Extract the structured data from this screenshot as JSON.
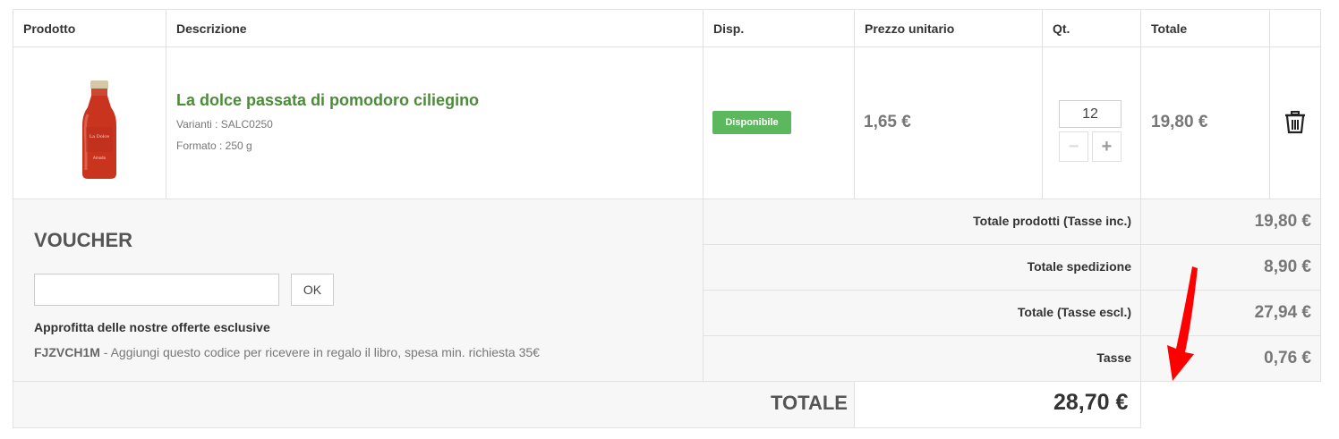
{
  "headers": {
    "product": "Prodotto",
    "description": "Descrizione",
    "availability": "Disp.",
    "unit_price": "Prezzo unitario",
    "qty": "Qt.",
    "total": "Totale"
  },
  "item": {
    "name": "La dolce passata di pomodoro ciliegino",
    "variant": "Varianti : SALC0250",
    "format": "Formato : 250 g",
    "availability": "Disponibile",
    "unit_price": "1,65 €",
    "quantity": "12",
    "total": "19,80 €",
    "image_icon": "tomato-sauce-bottle"
  },
  "voucher": {
    "title": "VOUCHER",
    "input_value": "",
    "ok_label": "OK",
    "offer_title": "Approfitta delle nostre offerte esclusive",
    "offer_code": "FJZVCH1M",
    "offer_text": " - Aggiungi questo codice per ricevere in regalo il libro, spesa min. richiesta 35€"
  },
  "summary": [
    {
      "label": "Totale prodotti (Tasse inc.)",
      "value": "19,80 €"
    },
    {
      "label": "Totale spedizione",
      "value": "8,90 €"
    },
    {
      "label": "Totale (Tasse escl.)",
      "value": "27,94 €"
    },
    {
      "label": "Tasse",
      "value": "0,76 €"
    }
  ],
  "grand_total": {
    "label": "TOTALE",
    "value": "28,70 €"
  },
  "colors": {
    "product_link": "#4c8b3a",
    "badge": "#5cb85c",
    "arrow": "#ff0000"
  }
}
